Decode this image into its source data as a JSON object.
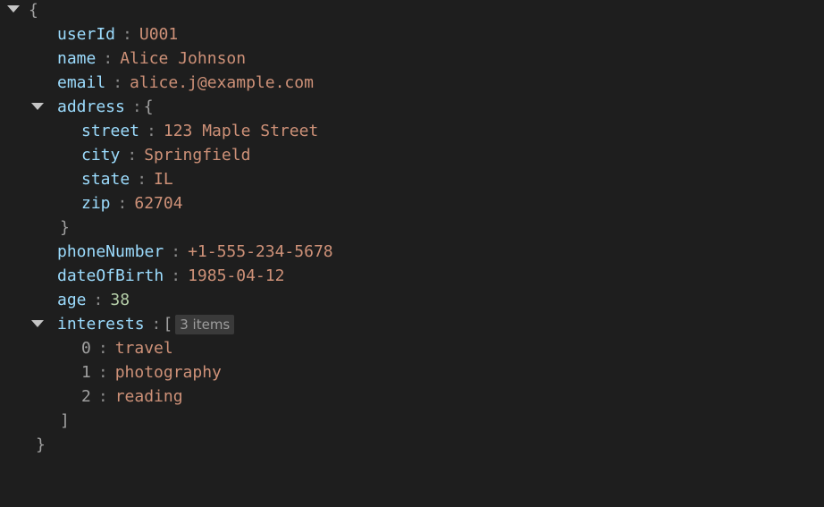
{
  "root": {
    "open_brace": "{",
    "close_brace": "}",
    "expanded": true
  },
  "fields": {
    "userId": {
      "key": "userId",
      "value": "U001",
      "type": "string"
    },
    "name": {
      "key": "name",
      "value": "Alice Johnson",
      "type": "string"
    },
    "email": {
      "key": "email",
      "value": "alice.j@example.com",
      "type": "string"
    },
    "address": {
      "key": "address",
      "open_brace": "{",
      "close_brace": "}",
      "expanded": true,
      "children": {
        "street": {
          "key": "street",
          "value": "123 Maple Street",
          "type": "string"
        },
        "city": {
          "key": "city",
          "value": "Springfield",
          "type": "string"
        },
        "state": {
          "key": "state",
          "value": "IL",
          "type": "string"
        },
        "zip": {
          "key": "zip",
          "value": "62704",
          "type": "string"
        }
      }
    },
    "phoneNumber": {
      "key": "phoneNumber",
      "value": "+1-555-234-5678",
      "type": "string"
    },
    "dateOfBirth": {
      "key": "dateOfBirth",
      "value": "1985-04-12",
      "type": "string"
    },
    "age": {
      "key": "age",
      "value": "38",
      "type": "number"
    },
    "interests": {
      "key": "interests",
      "open_bracket": "[",
      "close_bracket": "]",
      "count_badge": "3 items",
      "expanded": true,
      "items": [
        {
          "index": "0",
          "value": "travel"
        },
        {
          "index": "1",
          "value": "photography"
        },
        {
          "index": "2",
          "value": "reading"
        }
      ]
    }
  },
  "separator": ":",
  "colors": {
    "background": "#1e1e1e",
    "key": "#9cdcfe",
    "string": "#ce9178",
    "number": "#b5cea8",
    "punctuation": "#a0a0a0"
  }
}
